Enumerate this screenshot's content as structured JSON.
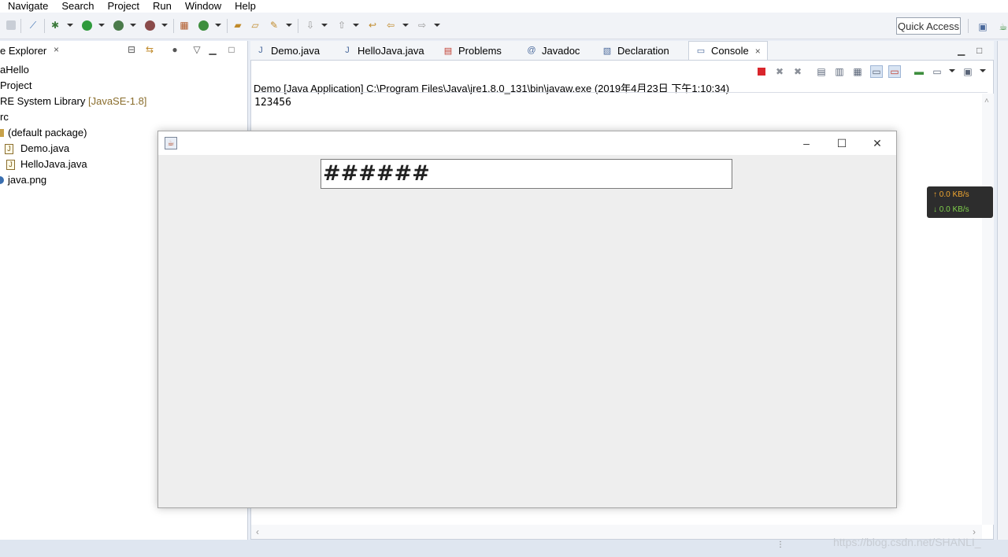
{
  "menu": [
    "Navigate",
    "Search",
    "Project",
    "Run",
    "Window",
    "Help"
  ],
  "quick_access": "Quick Access",
  "explorer": {
    "title": "e Explorer",
    "close": "×",
    "tree": [
      {
        "label": "aHello",
        "indent": 0
      },
      {
        "label": "Project",
        "indent": 0
      },
      {
        "label": "RE System Library ",
        "extra": "[JavaSE-1.8]",
        "indent": 0
      },
      {
        "label": "rc",
        "indent": 0
      },
      {
        "label": "(default package)",
        "indent": 1
      },
      {
        "label": "Demo.java",
        "indent": 2
      },
      {
        "label": "HelloJava.java",
        "indent": 2
      },
      {
        "label": "java.png",
        "indent": 1
      }
    ]
  },
  "tabs": {
    "demo": "Demo.java",
    "hellojava": "HelloJava.java",
    "problems": "Problems",
    "javadoc": "Javadoc",
    "declaration": "Declaration",
    "console": "Console"
  },
  "console": {
    "title": "Demo [Java Application] C:\\Program Files\\Java\\jre1.8.0_131\\bin\\javaw.exe (2019年4月23日 下午1:10:34)",
    "output": "123456"
  },
  "swing": {
    "field_value": "######"
  },
  "speed": {
    "up": "0.0 KB/s",
    "down": "0.0 KB/s"
  },
  "watermark": "https://blog.csdn.net/SHANLI_",
  "colors": {
    "accent_blue": "#4b6a9c",
    "terminate_red": "#d9262c",
    "up_color": "#f0a630",
    "down_color": "#7fd04c"
  }
}
